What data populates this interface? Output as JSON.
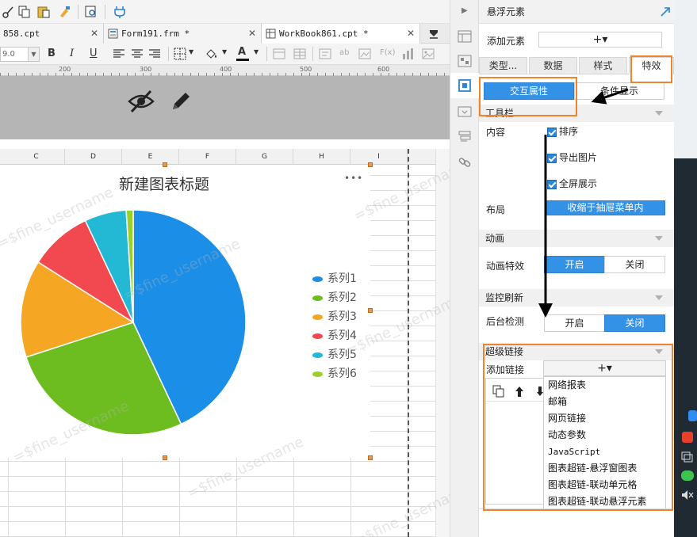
{
  "tabs": [
    {
      "label": "858.cpt"
    },
    {
      "label": "Form191.frm *"
    },
    {
      "label": "WorkBook861.cpt *"
    }
  ],
  "format_toolbar": {
    "font_size": "9.0",
    "bold": "B",
    "italic": "I",
    "underline": "U",
    "font_color_letter": "A",
    "ab": "ab",
    "fx": "F(x)"
  },
  "ruler": {
    "marks": [
      "200",
      "300",
      "400",
      "500",
      "600"
    ]
  },
  "columns": [
    "C",
    "D",
    "E",
    "F",
    "G",
    "H",
    "I"
  ],
  "chart_data": {
    "type": "pie",
    "title": "新建图表标题",
    "legend_position": "right",
    "categories": [
      "系列1",
      "系列2",
      "系列3",
      "系列4",
      "系列5",
      "系列6"
    ],
    "values": [
      43,
      27,
      14,
      9,
      6,
      1
    ],
    "colors": [
      "#1b8ee8",
      "#6ebd20",
      "#f5a623",
      "#f2484f",
      "#23b9d4",
      "#9ccf2c"
    ]
  },
  "chart_menu_glyph": "•••",
  "watermark_text": "=$fine_username",
  "panel": {
    "title": "悬浮元素",
    "add_element_label": "添加元素",
    "add_symbol": "+▾",
    "tabs": [
      "类型...",
      "数据",
      "样式",
      "特效"
    ],
    "subtabs": [
      "交互属性",
      "条件显示"
    ],
    "toolbar_section": "工具栏",
    "content_label": "内容",
    "checkboxes": [
      "排序",
      "导出图片",
      "全屏展示"
    ],
    "layout_label": "布局",
    "layout_value": "收缩于抽屉菜单内",
    "animation_section": "动画",
    "animation_effect_label": "动画特效",
    "animation_options": [
      "开启",
      "关闭"
    ],
    "monitor_section": "监控刷新",
    "background_check_label": "后台检测",
    "background_options": [
      "开启",
      "关闭"
    ],
    "hyperlink_section": "超级链接",
    "add_link_label": "添加链接",
    "link_types": [
      "网络报表",
      "邮箱",
      "网页链接",
      "动态参数",
      "JavaScript",
      "图表超链-悬浮窗图表",
      "图表超链-联动单元格",
      "图表超链-联动悬浮元素"
    ]
  },
  "colors": {
    "accent_blue": "#3391e6",
    "highlight_orange": "#f0832d",
    "hidden_zone": "#b5b5b5"
  }
}
